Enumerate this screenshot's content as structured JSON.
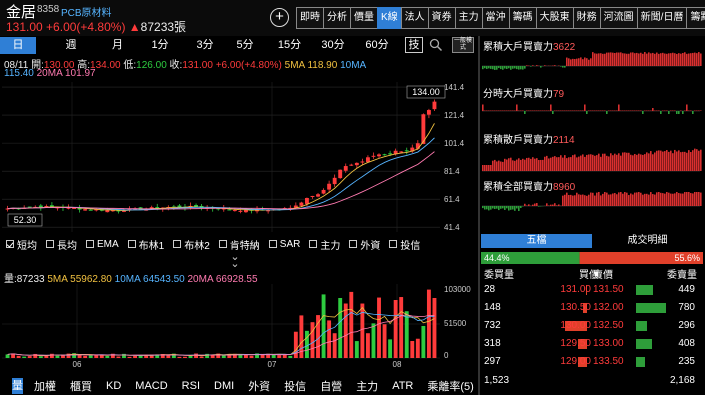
{
  "header": {
    "name": "金居",
    "code": "8358",
    "industry": "PCB原材料",
    "price": "131.00",
    "change": "+6.00(+4.80%)",
    "volume": "87233張",
    "up_arrow": "▲"
  },
  "nav_tabs": [
    "即時",
    "分析",
    "價量",
    "K線",
    "法人",
    "資券",
    "主力",
    "當沖",
    "籌碼",
    "大股東",
    "財務",
    "河流圖",
    "新聞/日曆",
    "籌點/公司"
  ],
  "nav_active": "K線",
  "periods": [
    "日",
    "週",
    "月",
    "1分",
    "3分",
    "5分",
    "15分",
    "30分",
    "60分"
  ],
  "period_active": "日",
  "tech_label": "技",
  "layout_label": "一般模式",
  "info": {
    "date": "08/11",
    "open_label": "開:",
    "open": "130.00",
    "high_label": "高:",
    "high": "134.00",
    "low_label": "低:",
    "low": "126.00",
    "close_label": "收:",
    "close": "131.00",
    "chg": "+6.00(+4.80%)",
    "ma5": "5MA 118.90",
    "ma10": "10MA",
    "ma10_val": "115.40",
    "ma20": "20MA 101.97"
  },
  "kchart": {
    "y_ticks": [
      "141.4",
      "121.4",
      "101.4",
      "81.4",
      "61.4",
      "41.4"
    ],
    "y_values": [
      141.4,
      121.4,
      101.4,
      81.4,
      61.4,
      41.4
    ],
    "max_label": "134.00",
    "min_label": "52.30"
  },
  "indicators": [
    {
      "label": "短均",
      "checked": true
    },
    {
      "label": "長均",
      "checked": false
    },
    {
      "label": "EMA",
      "checked": false
    },
    {
      "label": "布林1",
      "checked": false
    },
    {
      "label": "布林2",
      "checked": false
    },
    {
      "label": "肯特納",
      "checked": false
    },
    {
      "label": "SAR",
      "checked": false
    },
    {
      "label": "主力",
      "checked": false
    },
    {
      "label": "外資",
      "checked": false
    },
    {
      "label": "投信",
      "checked": false
    }
  ],
  "volinfo": {
    "vol_label": "量:",
    "vol": "87233",
    "ma5": "5MA 55962.80",
    "ma10": "10MA 64543.50",
    "ma20": "20MA 66928.55"
  },
  "volchart": {
    "y_ticks": [
      "103000",
      "51500",
      "0"
    ],
    "x_ticks": [
      "06",
      "07",
      "08"
    ]
  },
  "bottom_tabs": [
    "量",
    "加權",
    "櫃買",
    "KD",
    "MACD",
    "RSI",
    "DMI",
    "外資",
    "投信",
    "自營",
    "主力",
    "ATR",
    "乘離率(5)"
  ],
  "bottom_active": "量",
  "panels": [
    {
      "title": "累積大戶買賣力",
      "value": "3622"
    },
    {
      "title": "分時大戶買賣力",
      "value": "79"
    },
    {
      "title": "累積散戶買賣力",
      "value": "2114"
    },
    {
      "title": "累積全部買賣力",
      "value": "8960"
    }
  ],
  "orderbook": {
    "tabs": [
      "五檔",
      "成交明細"
    ],
    "active_tab": "五檔",
    "buy_pct": "44.4%",
    "sell_pct": "55.6%",
    "buy_frac": 0.444,
    "headers": [
      "委買量",
      "買價",
      "賣價",
      "委賣量"
    ],
    "rows": [
      {
        "bq": "28",
        "bp": "131.00",
        "ap": "131.50",
        "aq": "449",
        "bfrac": 0.04,
        "afrac": 0.58
      },
      {
        "bq": "148",
        "bp": "130.50",
        "ap": "132.00",
        "aq": "780",
        "bfrac": 0.2,
        "afrac": 1.0
      },
      {
        "bq": "732",
        "bp": "130.00",
        "ap": "132.50",
        "aq": "296",
        "bfrac": 1.0,
        "afrac": 0.38
      },
      {
        "bq": "318",
        "bp": "129.50",
        "ap": "133.00",
        "aq": "408",
        "bfrac": 0.43,
        "afrac": 0.52
      },
      {
        "bq": "297",
        "bp": "129.00",
        "ap": "133.50",
        "aq": "235",
        "bfrac": 0.41,
        "afrac": 0.3
      }
    ],
    "total_buy": "1,523",
    "total_sell": "2,168"
  },
  "colors": {
    "up": "#ff3b3b",
    "down": "#2ecc40",
    "accent": "#2f7fd6",
    "ma5": "#f0c040",
    "ma10": "#56b4ff",
    "ma20": "#ff7ab0"
  }
}
